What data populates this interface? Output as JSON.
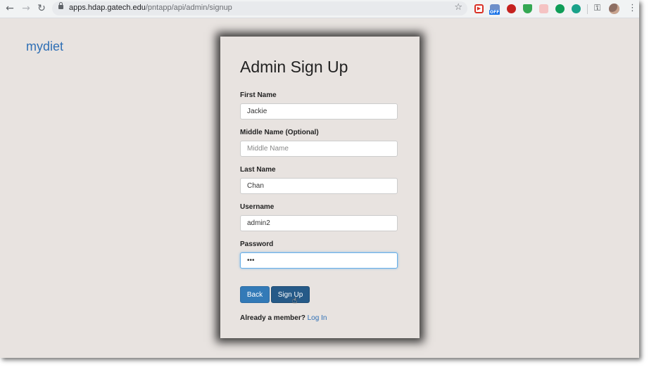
{
  "browser": {
    "url_host": "apps.hdap.gatech.edu",
    "url_path": "/pntapp/api/admin/signup",
    "extension_badge": "OFF"
  },
  "brand": "mydiet",
  "form": {
    "title": "Admin Sign Up",
    "first_name": {
      "label": "First Name",
      "value": "Jackie",
      "placeholder": ""
    },
    "middle_name": {
      "label": "Middle Name (Optional)",
      "value": "",
      "placeholder": "Middle Name"
    },
    "last_name": {
      "label": "Last Name",
      "value": "Chan",
      "placeholder": ""
    },
    "username": {
      "label": "Username",
      "value": "admin2",
      "placeholder": ""
    },
    "password": {
      "label": "Password",
      "value": "abc",
      "placeholder": ""
    },
    "back_label": "Back",
    "signup_label": "Sign Up",
    "member_text": "Already a member?",
    "login_link": "Log In"
  },
  "colors": {
    "page_bg": "#e8e3e0",
    "link": "#2f6fb5",
    "primary_button": "#337ab7",
    "primary_button_active": "#265a88"
  },
  "icons": [
    "back-arrow-icon",
    "forward-arrow-icon",
    "reload-icon",
    "lock-icon",
    "bookmark-star-icon",
    "key-icon",
    "profile-avatar",
    "menu-dots-icon"
  ]
}
